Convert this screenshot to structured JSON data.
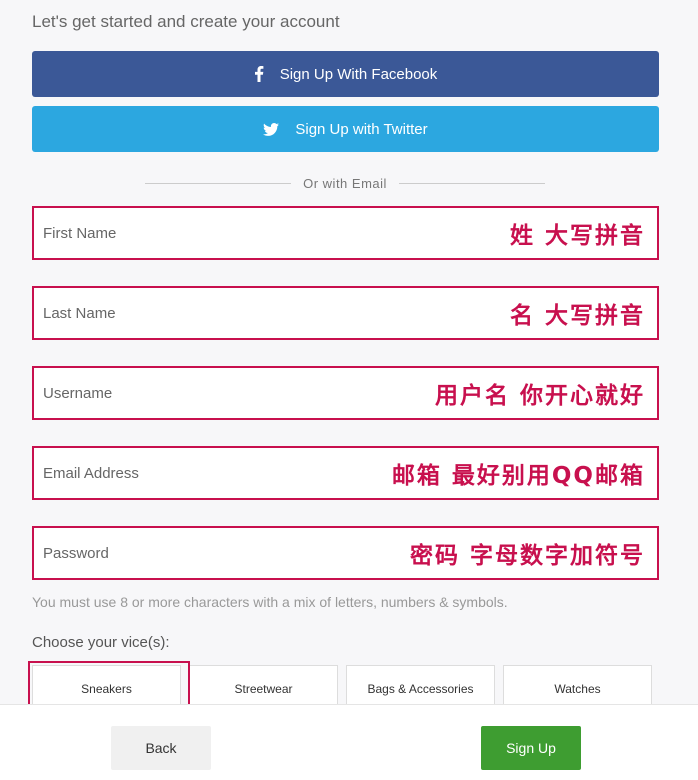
{
  "heading": "Let's get started and create your account",
  "social": {
    "facebook_label": "Sign Up With Facebook",
    "twitter_label": "Sign Up with Twitter",
    "facebook_color": "#3b5897",
    "twitter_color": "#2ca7e0"
  },
  "divider_text": "Or with Email",
  "fields": [
    {
      "placeholder": "First Name",
      "value": "",
      "note": "姓  大写拼音"
    },
    {
      "placeholder": "Last Name",
      "value": "",
      "note": "名  大写拼音"
    },
    {
      "placeholder": "Username",
      "value": "",
      "note": "用户名  你开心就好"
    },
    {
      "placeholder": "Email Address",
      "value": "",
      "note": "邮箱  最好别用QQ邮箱"
    },
    {
      "placeholder": "Password",
      "value": "",
      "note": "密码  字母数字加符号"
    }
  ],
  "password_hint": "You must use 8 or more characters with a mix of letters, numbers & symbols.",
  "vice_label": "Choose your vice(s):",
  "vices": [
    "Sneakers",
    "Streetwear",
    "Bags & Accessories",
    "Watches"
  ],
  "footer": {
    "back_label": "Back",
    "signup_label": "Sign Up",
    "signup_color": "#3e9d31"
  },
  "annotation_color": "#c8104e",
  "icons": {
    "facebook": "facebook-icon",
    "twitter": "twitter-icon"
  }
}
